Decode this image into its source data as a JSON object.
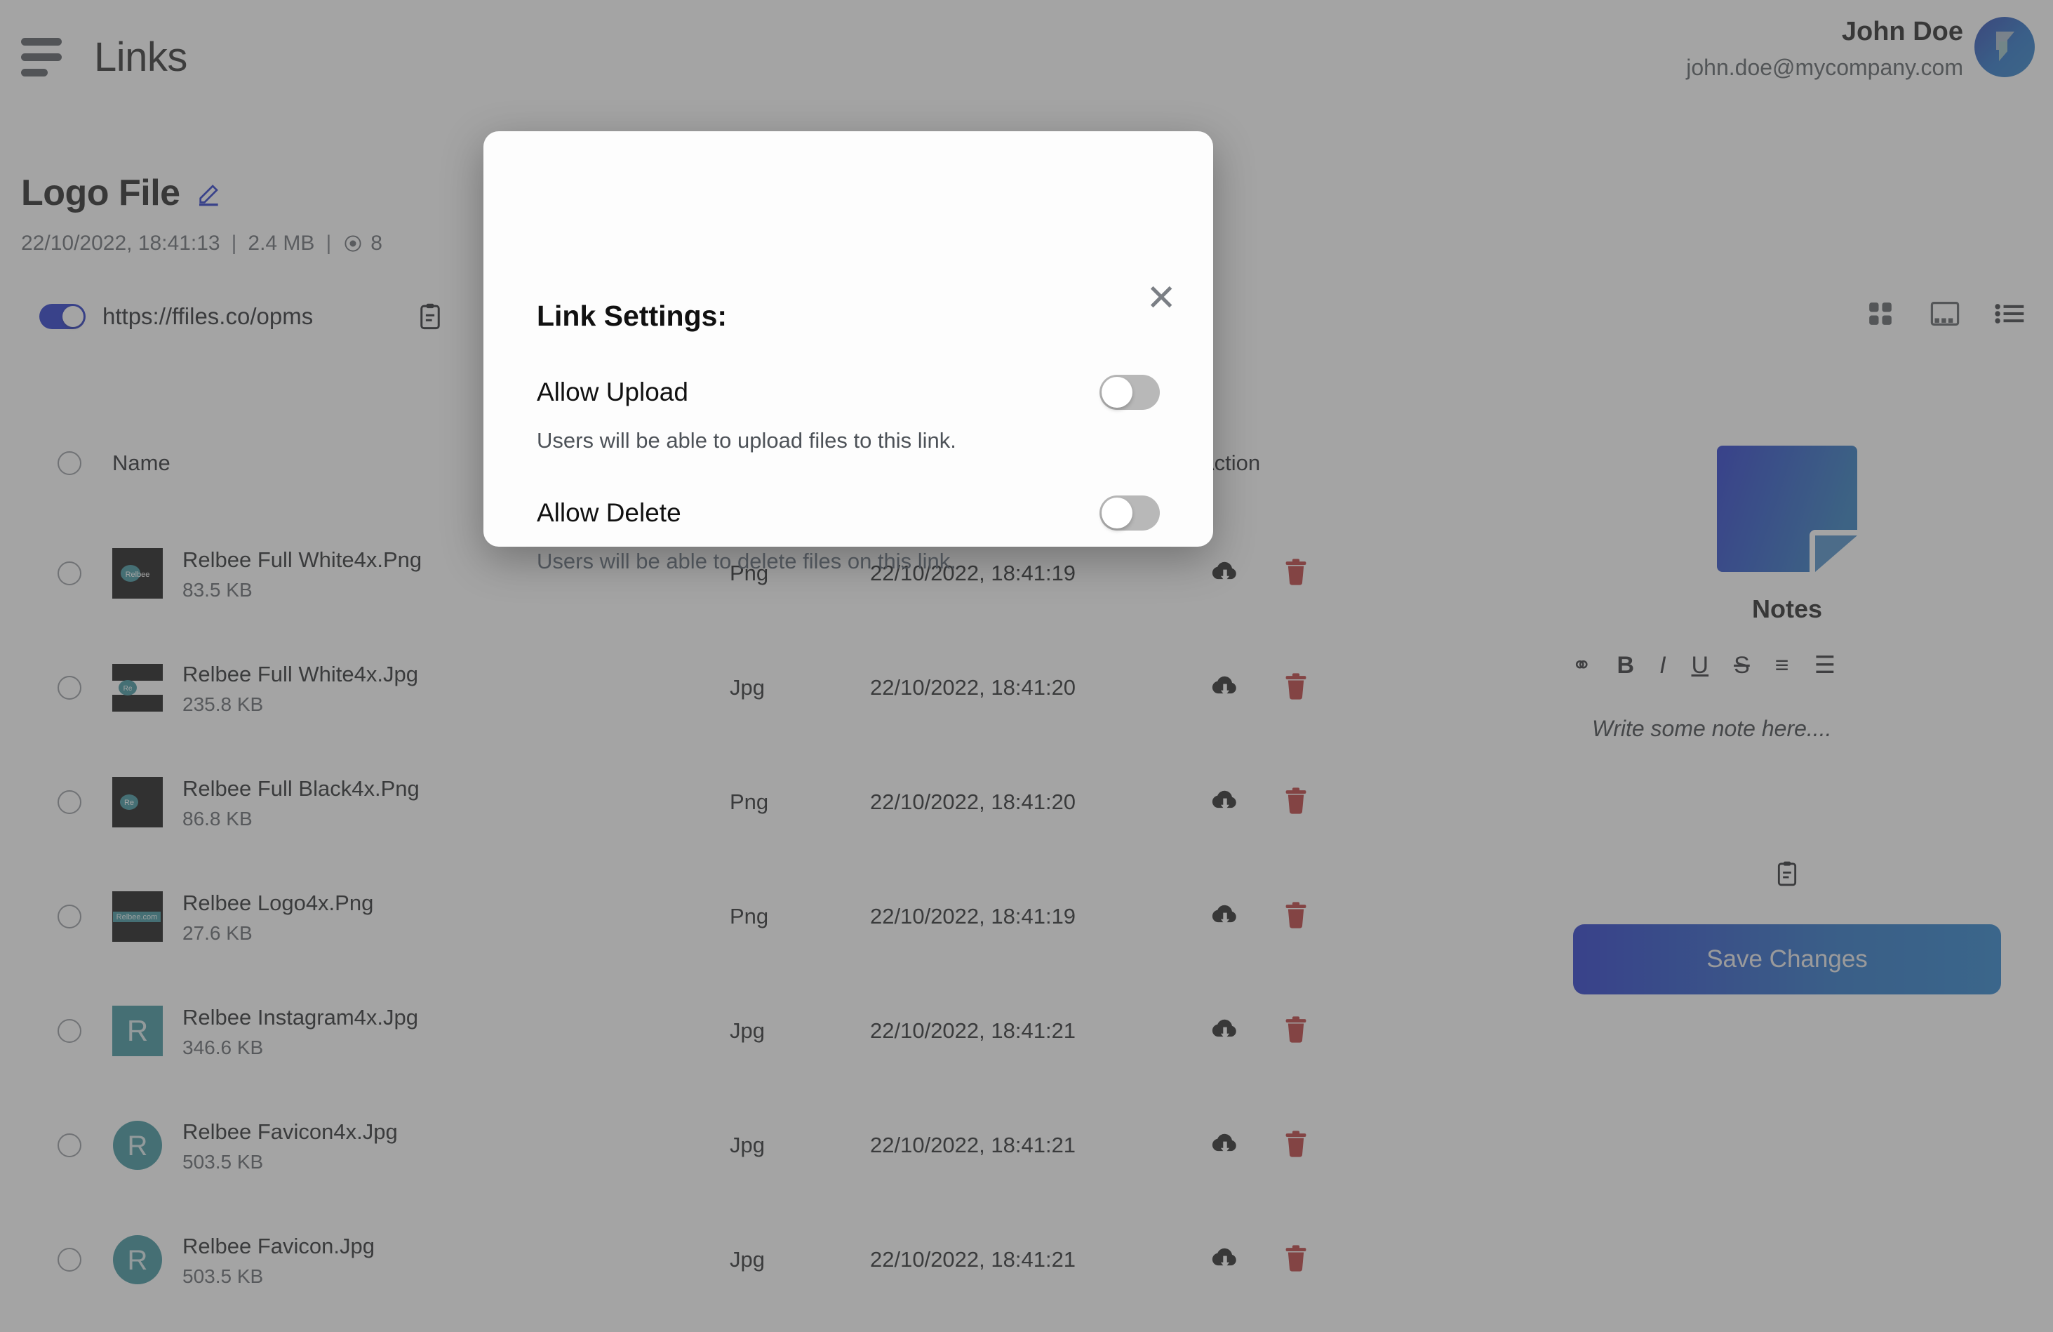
{
  "header": {
    "title": "Links",
    "menu_icon": "hamburger-menu-icon",
    "user_name": "John Doe",
    "user_email": "john.doe@mycompany.com",
    "avatar_icon": "brand-logo-avatar"
  },
  "file": {
    "name": "Logo File",
    "edit_icon": "pencil-edit-icon",
    "date": "22/10/2022, 18:41:13",
    "separator": "|",
    "size": "2.4 MB",
    "views_icon": "eye-icon",
    "views": "8",
    "link_url": "https://ffiles.co/opms",
    "link_enabled": true,
    "copy_icon": "clipboard-icon"
  },
  "view_switch": {
    "grid_label": "grid-view",
    "gallery_label": "gallery-view",
    "list_label": "list-view"
  },
  "table": {
    "columns": [
      "Name",
      "",
      "",
      "Action"
    ],
    "header_name": "Name",
    "header_action": "Action",
    "rows": [
      {
        "name": "Relbee Full White4x.Png",
        "size": "83.5 KB",
        "type": "Png",
        "date": "22/10/2022, 18:41:19",
        "thumb": "black-teal-relbee-wide"
      },
      {
        "name": "Relbee Full White4x.Jpg",
        "size": "235.8 KB",
        "type": "Jpg",
        "date": "22/10/2022, 18:41:20",
        "thumb": "black-bars-relbee"
      },
      {
        "name": "Relbee Full Black4x.Png",
        "size": "86.8 KB",
        "type": "Png",
        "date": "22/10/2022, 18:41:20",
        "thumb": "black-square-re"
      },
      {
        "name": "Relbee Logo4x.Png",
        "size": "27.6 KB",
        "type": "Png",
        "date": "22/10/2022, 18:41:19",
        "thumb": "black-relbee-com"
      },
      {
        "name": "Relbee Instagram4x.Jpg",
        "size": "346.6 KB",
        "type": "Jpg",
        "date": "22/10/2022, 18:41:21",
        "thumb": "teal-square-r"
      },
      {
        "name": "Relbee Favicon4x.Jpg",
        "size": "503.5 KB",
        "type": "Jpg",
        "date": "22/10/2022, 18:41:21",
        "thumb": "teal-circle-r"
      },
      {
        "name": "Relbee Favicon.Jpg",
        "size": "503.5 KB",
        "type": "Jpg",
        "date": "22/10/2022, 18:41:21",
        "thumb": "teal-circle-r"
      }
    ],
    "download_icon": "cloud-download-icon",
    "delete_icon": "trash-delete-icon"
  },
  "notes": {
    "title": "Notes",
    "doc_icon": "note-document-icon",
    "toolbar": [
      {
        "name": "link-icon",
        "glyph": "⚭"
      },
      {
        "name": "bold-icon",
        "glyph": "B"
      },
      {
        "name": "italic-icon",
        "glyph": "I"
      },
      {
        "name": "underline-icon",
        "glyph": "U"
      },
      {
        "name": "strikethrough-icon",
        "glyph": "S"
      },
      {
        "name": "ordered-list-icon",
        "glyph": "≡"
      },
      {
        "name": "bullet-list-icon",
        "glyph": "☰"
      }
    ],
    "placeholder": "Write some note here....",
    "copy_icon": "clipboard-icon",
    "save_label": "Save Changes"
  },
  "modal": {
    "title": "Link Settings:",
    "close_icon": "close-x-icon",
    "settings": [
      {
        "label": "Allow Upload",
        "description": "Users will be able to upload files to this link.",
        "enabled": false
      },
      {
        "label": "Allow Delete",
        "description": "Users will be able to delete files on this link.",
        "enabled": false
      }
    ]
  },
  "colors": {
    "brand_blue": "#1226c6",
    "accent_blue": "#1565c0",
    "delete_red": "#b52b2b",
    "thumb_teal": "#2e8a96"
  }
}
